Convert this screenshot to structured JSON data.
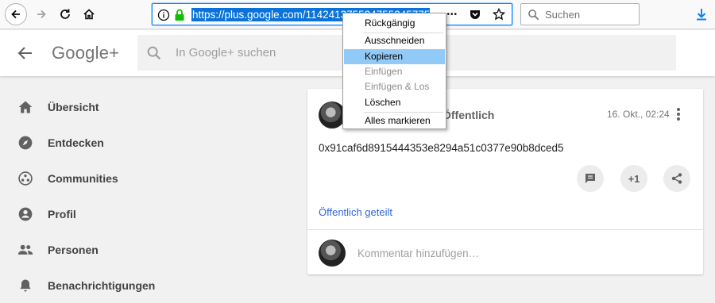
{
  "browser": {
    "url": "https://plus.google.com/114241375524755345775/",
    "search_placeholder": "Suchen",
    "more_glyph": "•••"
  },
  "header": {
    "logo": "Google+",
    "search_placeholder": "In Google+ suchen"
  },
  "sidebar": {
    "items": [
      {
        "label": "Übersicht",
        "icon": "home-icon"
      },
      {
        "label": "Entdecken",
        "icon": "compass-icon"
      },
      {
        "label": "Communities",
        "icon": "communities-icon"
      },
      {
        "label": "Profil",
        "icon": "profile-icon"
      },
      {
        "label": "Personen",
        "icon": "people-icon"
      },
      {
        "label": "Benachrichtigungen",
        "icon": "bell-icon"
      }
    ]
  },
  "post": {
    "visibility": "Öffentlich",
    "timestamp": "16. Okt., 02:24",
    "content": "0x91caf6d8915444353e8294a51c0377e90b8dced5",
    "plus_one": "+1",
    "shared_label": "Öffentlich geteilt",
    "comment_placeholder": "Kommentar hinzufügen…"
  },
  "context_menu": {
    "items": [
      {
        "label": "Rückgängig",
        "disabled": false
      },
      {
        "label": "Ausschneiden",
        "disabled": false
      },
      {
        "label": "Kopieren",
        "disabled": false,
        "active": true
      },
      {
        "label": "Einfügen",
        "disabled": true
      },
      {
        "label": "Einfügen & Los",
        "disabled": true
      },
      {
        "label": "Löschen",
        "disabled": false
      },
      {
        "label": "Alles markieren",
        "disabled": false
      }
    ]
  },
  "colors": {
    "accent": "#0a84ff",
    "selection": "#0a73db",
    "menu_highlight": "#91c9f7",
    "lock": "#12bc00",
    "link": "#3367d6"
  }
}
